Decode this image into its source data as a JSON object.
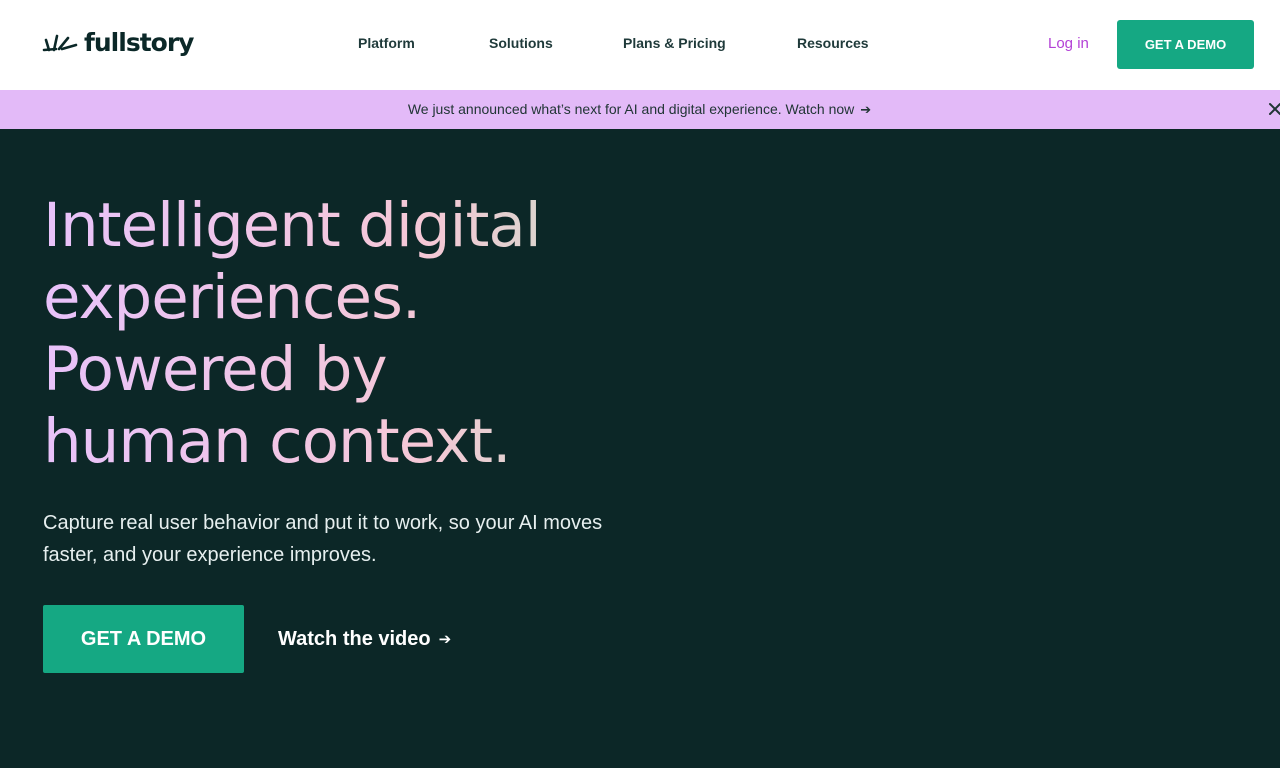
{
  "brand": {
    "name": "fullstory",
    "logo_icon": "leaf-fan-icon"
  },
  "nav": {
    "items": [
      {
        "label": "Platform"
      },
      {
        "label": "Solutions"
      },
      {
        "label": "Plans & Pricing"
      },
      {
        "label": "Resources"
      }
    ],
    "login_label": "Log in",
    "cta_label": "GET A DEMO"
  },
  "banner": {
    "text": "We just announced what’s next for AI and digital experience. Watch now",
    "arrow": "➔",
    "close_icon": "close-icon"
  },
  "hero": {
    "headline": [
      "Intelligent digital",
      "experiences.",
      "Powered by",
      "human context."
    ],
    "subtext": "Capture real user behavior and put it to work, so your AI moves faster, and your experience improves.",
    "cta_label": "GET A DEMO",
    "video_label": "Watch the video",
    "video_arrow": "➔"
  },
  "colors": {
    "brand_green": "#15a883",
    "hero_bg": "#0c2727",
    "banner_bg": "#e3baf8",
    "login_purple": "#b341d6"
  }
}
